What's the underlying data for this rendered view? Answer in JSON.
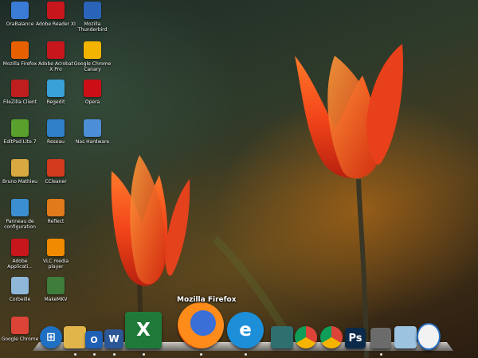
{
  "desktop": {
    "icons": [
      {
        "label": "OraBalance",
        "icon": "monitor-icon",
        "color": "#3a7bd5"
      },
      {
        "label": "Adobe Reader XI",
        "icon": "adobe-reader-icon",
        "color": "#c8161d"
      },
      {
        "label": "Mozilla Thunderbird",
        "icon": "thunderbird-icon",
        "color": "#2a64b8"
      },
      {
        "label": "Mozilla Firefox",
        "icon": "firefox-icon",
        "color": "#e66000"
      },
      {
        "label": "Adobe Acrobat X Pro",
        "icon": "acrobat-icon",
        "color": "#c8161d"
      },
      {
        "label": "Google Chrome Canary",
        "icon": "chrome-canary-icon",
        "color": "#f2b400"
      },
      {
        "label": "FileZilla Client",
        "icon": "filezilla-icon",
        "color": "#bf1e1e"
      },
      {
        "label": "Regedit",
        "icon": "regedit-icon",
        "color": "#3aa0d8"
      },
      {
        "label": "Opera",
        "icon": "opera-icon",
        "color": "#cc0f16"
      },
      {
        "label": "EditPad Lite 7",
        "icon": "editpad-icon",
        "color": "#5aa02c"
      },
      {
        "label": "Reseau",
        "icon": "network-icon",
        "color": "#2f7fc9"
      },
      {
        "label": "Nas Hardware",
        "icon": "computer-icon",
        "color": "#4d8fd6"
      },
      {
        "label": "Bruno Mathieu",
        "icon": "user-folder-icon",
        "color": "#d8a940"
      },
      {
        "label": "CCleaner",
        "icon": "ccleaner-icon",
        "color": "#d23b1e"
      },
      {
        "label": "Panneau de configuration",
        "icon": "control-panel-icon",
        "color": "#3b8fd0"
      },
      {
        "label": "Reflect",
        "icon": "reflect-icon",
        "color": "#e07a1a"
      },
      {
        "label": "Adobe Applicati...",
        "icon": "adobe-icon",
        "color": "#c8161d"
      },
      {
        "label": "VLC media player",
        "icon": "vlc-icon",
        "color": "#f08a00"
      },
      {
        "label": "Corbeille",
        "icon": "recycle-bin-icon",
        "color": "#8fb7d8"
      },
      {
        "label": "MakeMKV",
        "icon": "makemkv-icon",
        "color": "#3e7d3a"
      },
      {
        "label": "Google Chrome",
        "icon": "chrome-icon",
        "color": "#db4437"
      }
    ]
  },
  "dock": {
    "tooltip": "Mozilla Firefox",
    "items": [
      {
        "icon": "windows-start-icon",
        "glyph": "⊞",
        "color": "#1f6fc2"
      },
      {
        "icon": "folder-icon",
        "glyph": "",
        "color": "#e2b54a"
      },
      {
        "icon": "outlook-icon",
        "glyph": "O",
        "color": "#1f5fb4"
      },
      {
        "icon": "word-icon",
        "glyph": "W",
        "color": "#2b5797"
      },
      {
        "icon": "excel-icon",
        "glyph": "X",
        "color": "#1f7a3a"
      },
      {
        "icon": "firefox-icon",
        "glyph": "",
        "color": "#e66000"
      },
      {
        "icon": "internet-explorer-icon",
        "glyph": "e",
        "color": "#1d8fd8"
      },
      {
        "icon": "network-connections-icon",
        "glyph": "",
        "color": "#2f6f6f"
      },
      {
        "icon": "chrome-icon",
        "glyph": "",
        "color": "#db4437"
      },
      {
        "icon": "chrome-icon",
        "glyph": "",
        "color": "#db4437"
      },
      {
        "icon": "photoshop-icon",
        "glyph": "Ps",
        "color": "#0b2a4a"
      },
      {
        "icon": "settings-icon",
        "glyph": "",
        "color": "#6b6b6b"
      },
      {
        "icon": "recycle-bin-icon",
        "glyph": "",
        "color": "#9cc3e0"
      },
      {
        "icon": "clock-icon",
        "glyph": "",
        "color": "#f2f2f2"
      }
    ]
  }
}
